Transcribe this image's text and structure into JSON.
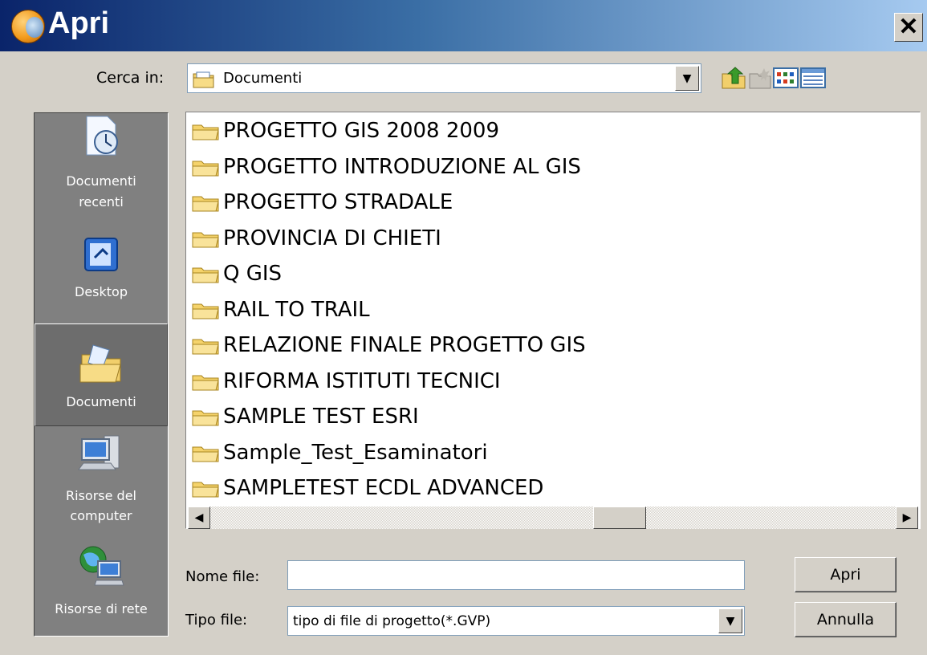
{
  "window": {
    "title": "Apri"
  },
  "look_in": {
    "label": "Cerca in:",
    "value": "Documenti"
  },
  "toolbar": {
    "icons": [
      "up-folder-icon",
      "new-folder-icon",
      "list-view-icon",
      "details-view-icon"
    ]
  },
  "places": [
    {
      "label_line1": "Documenti",
      "label_line2": "recenti",
      "icon": "recent-documents-icon",
      "selected": false
    },
    {
      "label_line1": "Desktop",
      "label_line2": "",
      "icon": "desktop-icon",
      "selected": false
    },
    {
      "label_line1": "Documenti",
      "label_line2": "",
      "icon": "documents-folder-icon",
      "selected": true
    },
    {
      "label_line1": "Risorse del",
      "label_line2": "computer",
      "icon": "my-computer-icon",
      "selected": false
    },
    {
      "label_line1": "Risorse di rete",
      "label_line2": "",
      "icon": "network-places-icon",
      "selected": false
    }
  ],
  "files": [
    "PROGETTO GIS 2008 2009",
    "PROGETTO INTRODUZIONE AL GIS",
    "PROGETTO STRADALE",
    "PROVINCIA DI CHIETI",
    "Q GIS",
    "RAIL TO TRAIL",
    "RELAZIONE FINALE PROGETTO GIS",
    "RIFORMA ISTITUTI TECNICI",
    "SAMPLE TEST ESRI",
    "Sample_Test_Esaminatori",
    "SAMPLETEST ECDL ADVANCED"
  ],
  "file_name": {
    "label": "Nome file:",
    "value": ""
  },
  "file_type": {
    "label": "Tipo file:",
    "value": "tipo di file di progetto(*.GVP)"
  },
  "buttons": {
    "open": "Apri",
    "cancel": "Annulla"
  },
  "colors": {
    "folder": "#f5d36b",
    "titlebar_start": "#0a246a",
    "titlebar_end": "#a6caf0"
  }
}
